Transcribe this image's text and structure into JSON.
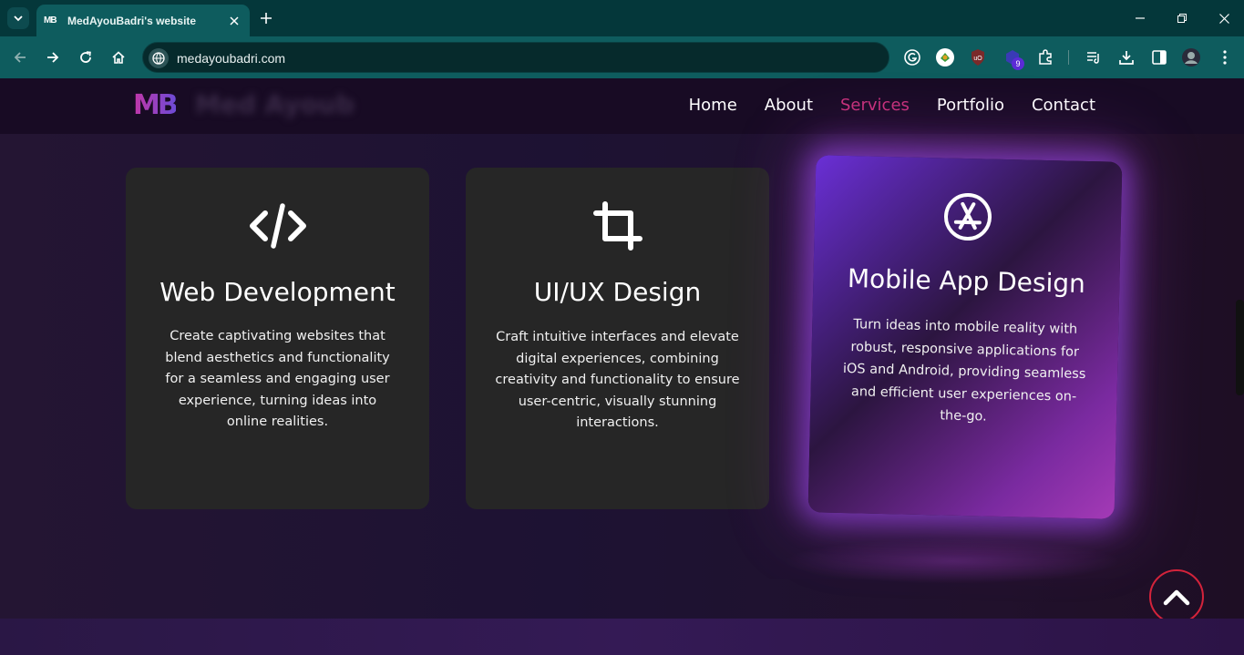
{
  "browser": {
    "tab": {
      "favicon_text": "MB",
      "title": "MedAyouBadri's website"
    },
    "url": "medayoubadri.com",
    "extension_badge": "9"
  },
  "site": {
    "logo": "MB",
    "logo_blurred": "Med Ayoub",
    "nav": [
      "Home",
      "About",
      "Services",
      "Portfolio",
      "Contact"
    ],
    "active_nav": "Services"
  },
  "services": [
    {
      "icon": "code-icon",
      "title": "Web Development",
      "description": "Create captivating websites that blend aesthetics and functionality for a seamless and engaging user experience, turning ideas into online realities."
    },
    {
      "icon": "crop-icon",
      "title": "UI/UX Design",
      "description": "Craft intuitive interfaces and elevate digital experiences, combining creativity and functionality to ensure user-centric, visually stunning interactions."
    },
    {
      "icon": "app-store-icon",
      "title": "Mobile App Design",
      "description": "Turn ideas into mobile reality with robust, responsive applications for iOS and Android, providing seamless and efficient user experiences on-the-go."
    }
  ],
  "colors": {
    "accent": "#c8327a",
    "scroll_button": "#d4233b",
    "glow": "#8a45e0"
  }
}
